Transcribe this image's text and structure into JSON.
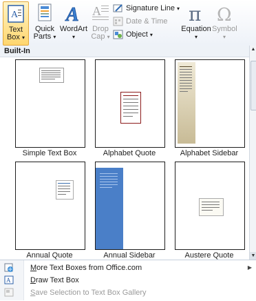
{
  "ribbon": {
    "text_box": {
      "line1": "Text",
      "line2": "Box"
    },
    "quick_parts": {
      "line1": "Quick",
      "line2": "Parts"
    },
    "wordart": {
      "line1": "WordArt"
    },
    "drop_cap": {
      "line1": "Drop",
      "line2": "Cap"
    },
    "signature_line": "Signature Line",
    "date_time": "Date & Time",
    "object": "Object",
    "equation": "Equation",
    "symbol": "Symbol",
    "accent_color": "#e3a83b",
    "disabled_color": "#9a9a9a"
  },
  "gallery": {
    "section_label": "Built-In",
    "items": [
      {
        "caption": "Simple Text Box"
      },
      {
        "caption": "Alphabet Quote"
      },
      {
        "caption": "Alphabet Sidebar"
      },
      {
        "caption": "Annual Quote"
      },
      {
        "caption": "Annual Sidebar"
      },
      {
        "caption": "Austere Quote"
      }
    ]
  },
  "menu": {
    "items": [
      {
        "label": "More Text Boxes from Office.com",
        "has_submenu": true,
        "enabled": true
      },
      {
        "label": "Draw Text Box",
        "enabled": true
      },
      {
        "label": "Save Selection to Text Box Gallery",
        "enabled": false
      }
    ]
  }
}
